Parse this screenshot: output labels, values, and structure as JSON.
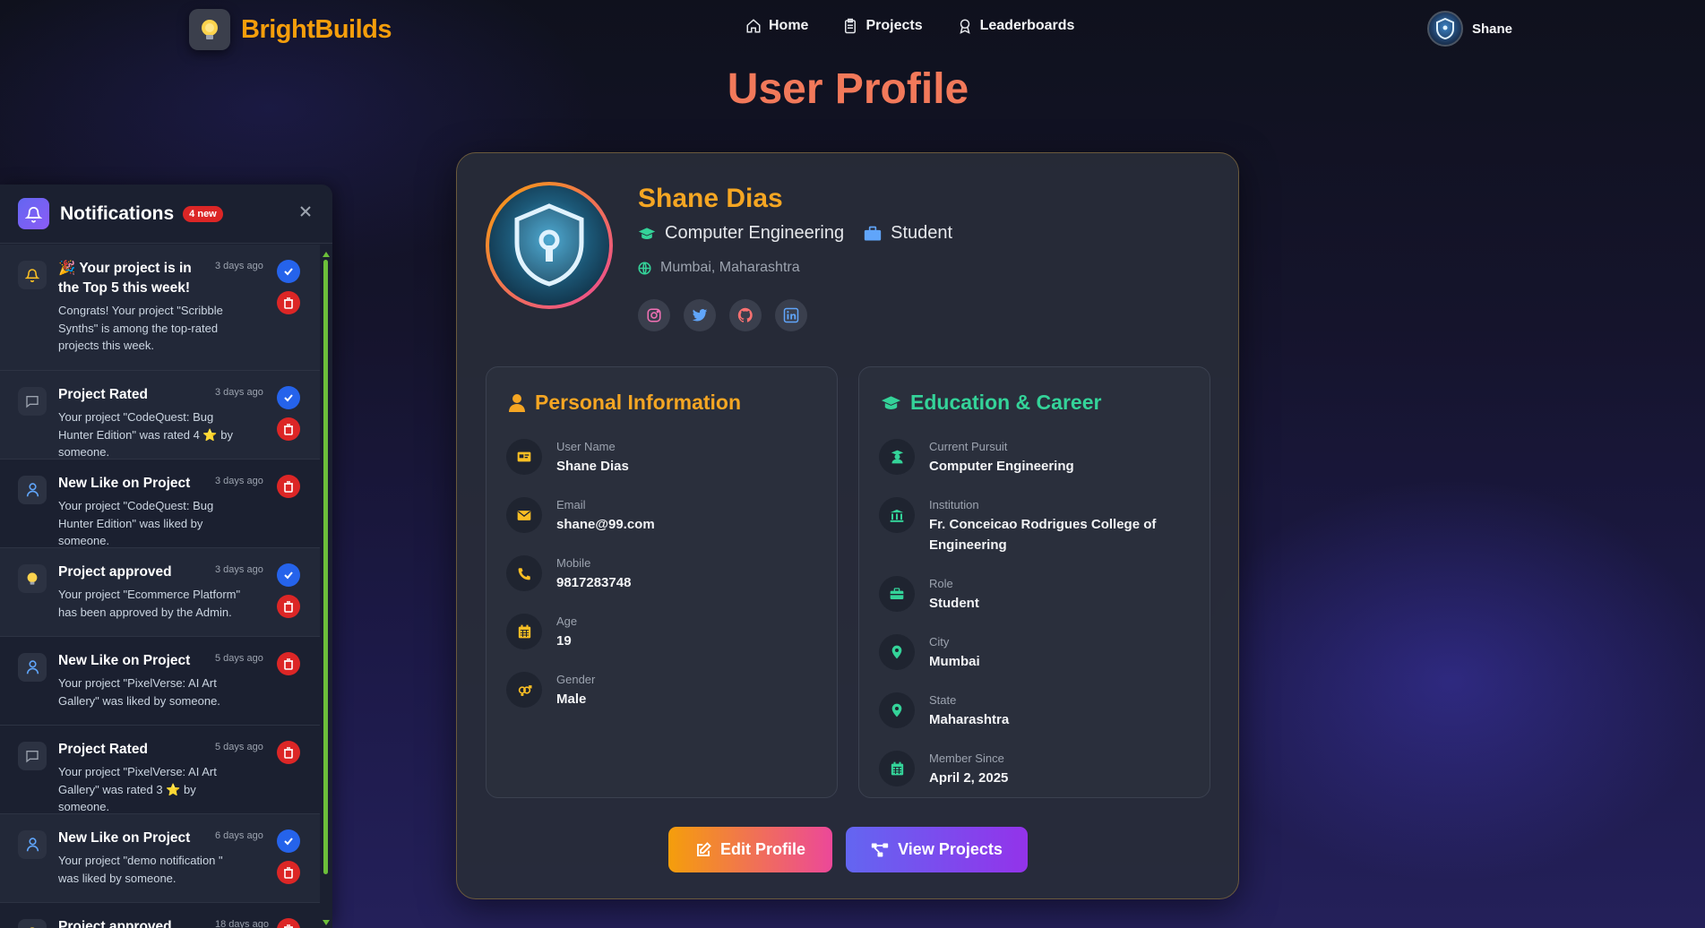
{
  "nav": {
    "brand": "BrightBuilds",
    "links": [
      {
        "label": "Home",
        "icon": "home-icon"
      },
      {
        "label": "Projects",
        "icon": "clipboard-icon"
      },
      {
        "label": "Leaderboards",
        "icon": "award-icon"
      }
    ],
    "user": "Shane"
  },
  "page": {
    "title": "User Profile"
  },
  "profile": {
    "name": "Shane Dias",
    "pursuit": "Computer Engineering",
    "role": "Student",
    "location": "Mumbai, Maharashtra",
    "socials": [
      "instagram",
      "twitter",
      "github",
      "linkedin"
    ]
  },
  "personal": {
    "title": "Personal Information",
    "fields": [
      {
        "label": "User Name",
        "value": "Shane Dias",
        "icon": "id-card-icon"
      },
      {
        "label": "Email",
        "value": "shane@99.com",
        "icon": "envelope-icon"
      },
      {
        "label": "Mobile",
        "value": "9817283748",
        "icon": "phone-icon"
      },
      {
        "label": "Age",
        "value": "19",
        "icon": "calendar-icon"
      },
      {
        "label": "Gender",
        "value": "Male",
        "icon": "gender-icon"
      }
    ]
  },
  "education": {
    "title": "Education & Career",
    "fields": [
      {
        "label": "Current Pursuit",
        "value": "Computer Engineering",
        "icon": "graduate-icon"
      },
      {
        "label": "Institution",
        "value": "Fr. Conceicao Rodrigues College of Engineering",
        "icon": "institution-icon"
      },
      {
        "label": "Role",
        "value": "Student",
        "icon": "briefcase-icon"
      },
      {
        "label": "City",
        "value": "Mumbai",
        "icon": "location-pin-icon"
      },
      {
        "label": "State",
        "value": "Maharashtra",
        "icon": "location-pin-icon"
      },
      {
        "label": "Member Since",
        "value": "April 2, 2025",
        "icon": "calendar-icon"
      }
    ]
  },
  "actions": {
    "edit": "Edit Profile",
    "view": "View Projects"
  },
  "notifications": {
    "title": "Notifications",
    "badge": "4 new",
    "items": [
      {
        "title": "🎉 Your project is in the Top 5 this week!",
        "body": "Congrats! Your project \"Scribble Synths\" is among the top-rated projects this week.",
        "time": "3 days ago",
        "icon": "bell-icon",
        "read_btn": true
      },
      {
        "title": "Project Rated",
        "body": "Your project \"CodeQuest: Bug Hunter Edition\" was rated 4 ⭐ by someone.",
        "time": "3 days ago",
        "icon": "comment-icon",
        "read_btn": true
      },
      {
        "title": "New Like on Project",
        "body": "Your project \"CodeQuest: Bug Hunter Edition\" was liked by someone.",
        "time": "3 days ago",
        "icon": "user-icon",
        "read_btn": false
      },
      {
        "title": "Project approved",
        "body": "Your project \"Ecommerce Platform\" has been approved by the Admin.",
        "time": "3 days ago",
        "icon": "bulb-icon",
        "read_btn": true
      },
      {
        "title": "New Like on Project",
        "body": "Your project \"PixelVerse: AI Art Gallery\" was liked by someone.",
        "time": "5 days ago",
        "icon": "user-icon",
        "read_btn": false
      },
      {
        "title": "Project Rated",
        "body": "Your project \"PixelVerse: AI Art Gallery\" was rated 3 ⭐ by someone.",
        "time": "5 days ago",
        "icon": "comment-icon",
        "read_btn": false
      },
      {
        "title": "New Like on Project",
        "body": "Your project \"demo notification \" was liked by someone.",
        "time": "6 days ago",
        "icon": "user-icon",
        "read_btn": true
      },
      {
        "title": "Project approved",
        "body": "",
        "time": "18 days ago",
        "icon": "bulb-icon",
        "read_btn": false
      }
    ]
  }
}
